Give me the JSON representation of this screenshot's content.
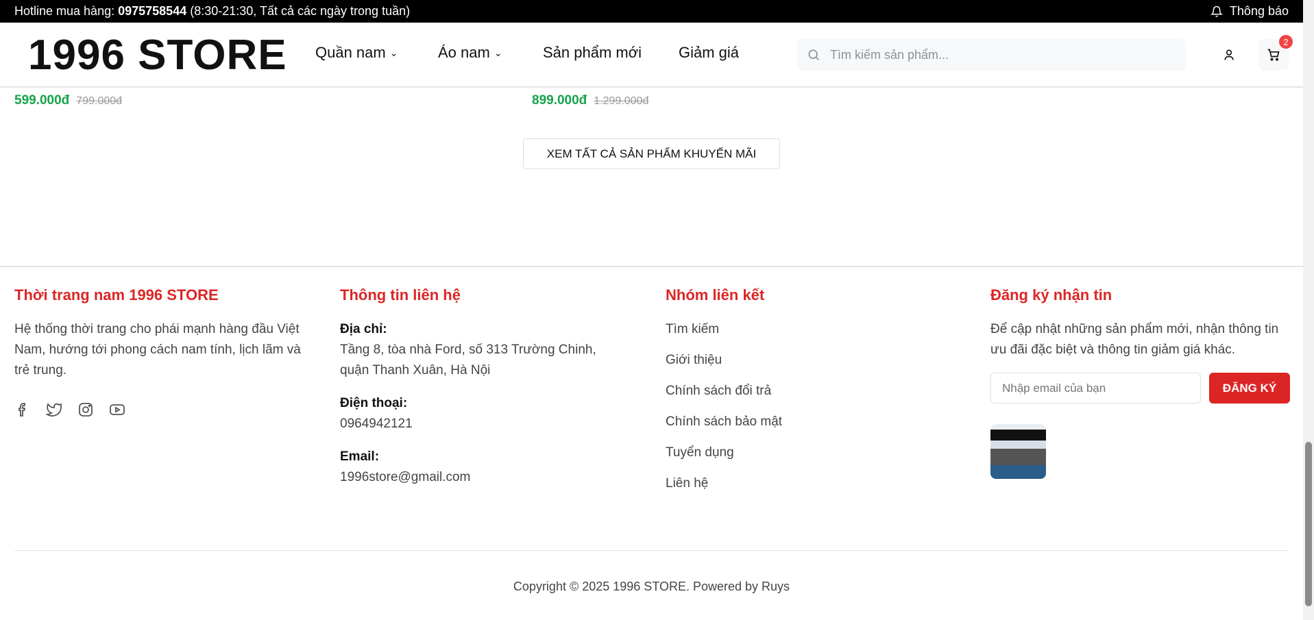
{
  "topbar": {
    "hotline_label": "Hotline mua hàng:",
    "hotline_number": "0975758544",
    "hotline_hours": "(8:30-21:30, Tất cả các ngày trong tuần)",
    "notifications": "Thông báo"
  },
  "header": {
    "logo": "1996 STORE",
    "nav": [
      {
        "label": "Quần nam"
      },
      {
        "label": "Áo nam"
      },
      {
        "label": "Sản phẩm mới"
      },
      {
        "label": "Giảm giá"
      }
    ],
    "search_placeholder": "Tìm kiếm sản phẩm...",
    "cart_count": "2"
  },
  "products": [
    {
      "price": "599.000đ",
      "old_price": "799.000đ"
    },
    {
      "price": "899.000đ",
      "old_price": "1.299.000đ"
    }
  ],
  "view_all": "XEM TẤT CẢ SẢN PHẨM KHUYẾN MÃI",
  "footer": {
    "about": {
      "title": "Thời trang nam 1996 STORE",
      "text": "Hệ thống thời trang cho phái mạnh hàng đầu Việt Nam, hướng tới phong cách nam tính, lịch lãm và trẻ trung."
    },
    "contact": {
      "title": "Thông tin liên hệ",
      "address_label": "Địa chỉ:",
      "address": "Tầng 8, tòa nhà Ford, số 313 Trường Chinh, quận Thanh Xuân, Hà Nội",
      "phone_label": "Điện thoại:",
      "phone": "0964942121",
      "email_label": "Email:",
      "email": "1996store@gmail.com"
    },
    "links": {
      "title": "Nhóm liên kết",
      "items": [
        "Tìm kiếm",
        "Giới thiệu",
        "Chính sách đổi trả",
        "Chính sách bảo mật",
        "Tuyển dụng",
        "Liên hệ"
      ]
    },
    "newsletter": {
      "title": "Đăng ký nhận tin",
      "text": "Để cập nhật những sản phẩm mới, nhận thông tin ưu đãi đặc biệt và thông tin giảm giá khác.",
      "placeholder": "Nhập email của bạn",
      "button": "ĐĂNG KÝ"
    },
    "copyright": "Copyright © 2025 1996 STORE. Powered by Ruys"
  },
  "colors": {
    "accent": "#dc2626",
    "price": "#16a34a"
  }
}
